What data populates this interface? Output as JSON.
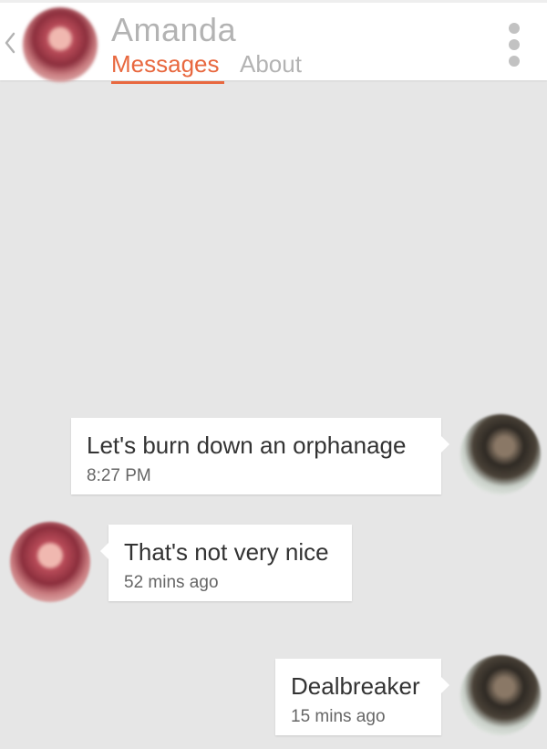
{
  "header": {
    "back_icon": "chevron-left-icon",
    "contact_name": "Amanda",
    "tabs": [
      {
        "label": "Messages",
        "active": true
      },
      {
        "label": "About",
        "active": false
      }
    ],
    "menu_icon": "more-vertical-icon",
    "accent_color": "#e8683f"
  },
  "messages": [
    {
      "sender": "self",
      "text": "Let's burn down an orphanage",
      "time": "8:27 PM"
    },
    {
      "sender": "contact",
      "text": "That's not very nice",
      "time": "52 mins ago"
    },
    {
      "sender": "self",
      "text": "Dealbreaker",
      "time": "15 mins ago"
    }
  ]
}
